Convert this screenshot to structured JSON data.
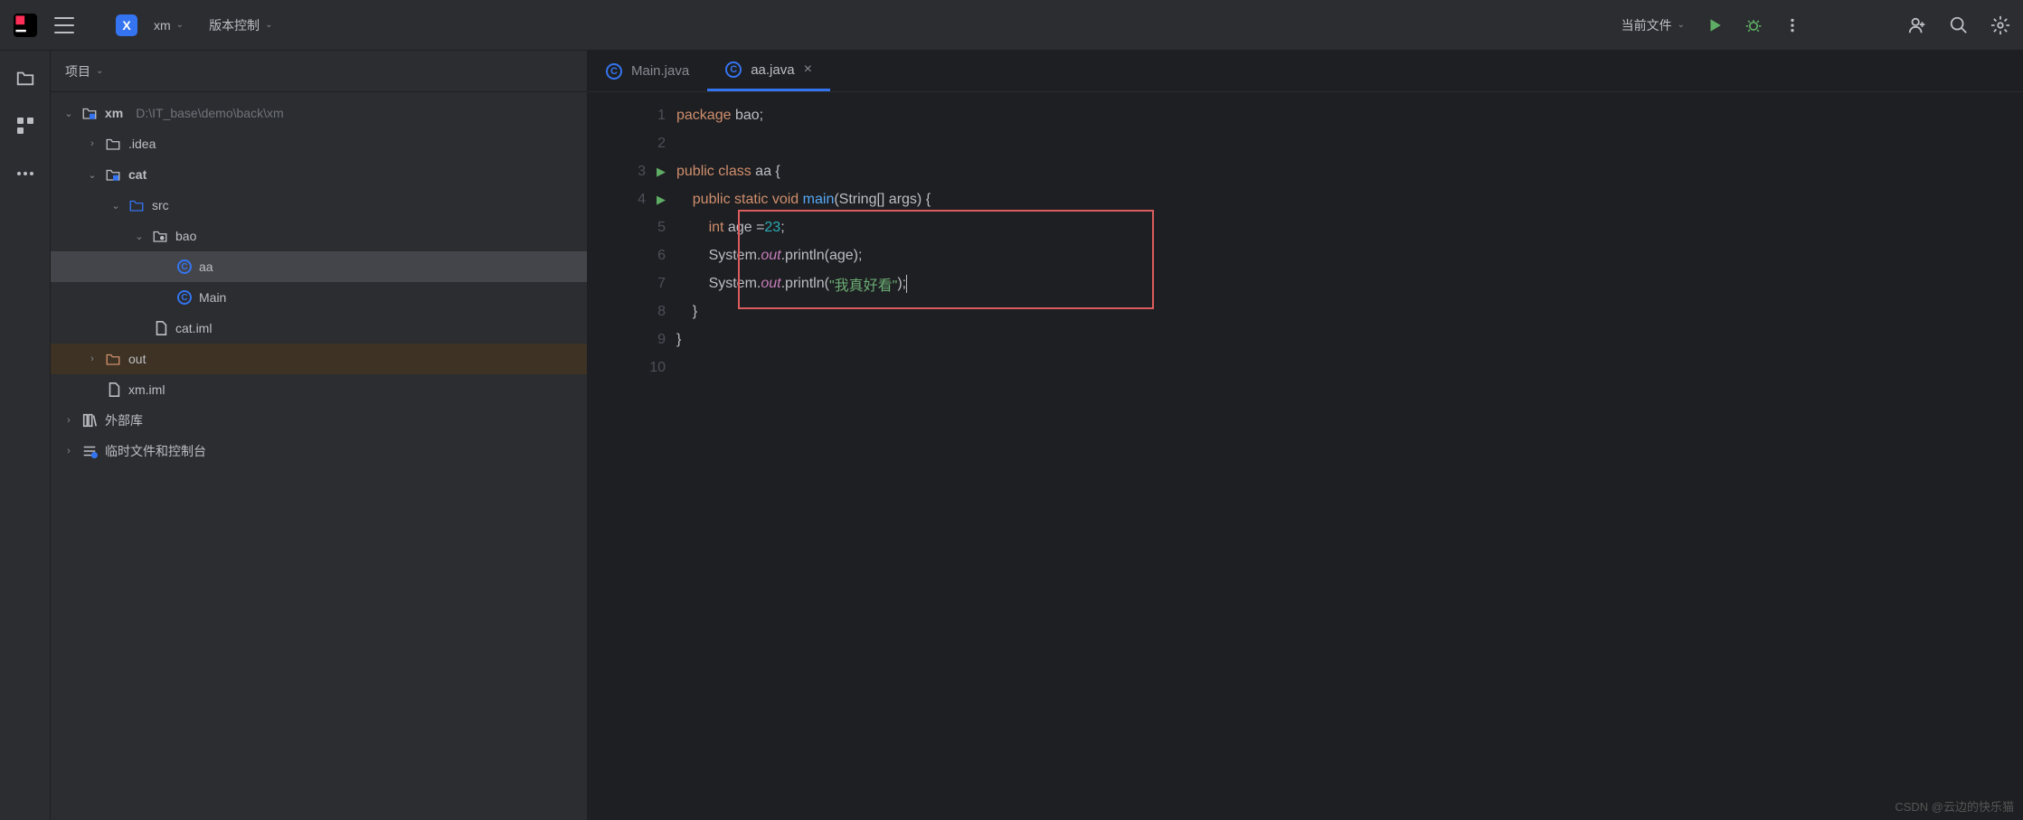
{
  "topbar": {
    "project_badge": "X",
    "project_name": "xm",
    "vcs_label": "版本控制",
    "run_config": "当前文件"
  },
  "sidebar": {
    "title": "项目",
    "root": {
      "name": "xm",
      "path": "D:\\IT_base\\demo\\back\\xm"
    },
    "idea": ".idea",
    "cat": "cat",
    "src": "src",
    "bao": "bao",
    "aa": "aa",
    "main": "Main",
    "catiml": "cat.iml",
    "out": "out",
    "xmiml": "xm.iml",
    "ext_lib": "外部库",
    "scratch": "临时文件和控制台"
  },
  "tabs": {
    "t1": "Main.java",
    "t2": "aa.java"
  },
  "lines": [
    "1",
    "2",
    "3",
    "4",
    "5",
    "6",
    "7",
    "8",
    "9",
    "10"
  ],
  "code": {
    "l1": {
      "pkg": "package",
      "sp": " ",
      "bao": "bao",
      "semi": ";"
    },
    "l3": {
      "pub": "public",
      "sp": " ",
      "cls": "class",
      "sp2": " ",
      "aa": "aa",
      "sp3": " ",
      "br": "{"
    },
    "l4": {
      "ind": "    ",
      "pub": "public",
      "sp": " ",
      "st": "static",
      "sp2": " ",
      "vd": "void",
      "sp3": " ",
      "main": "main",
      "par": "(String[] args) {"
    },
    "l5": {
      "ind": "        ",
      "int": "int",
      "sp": " ",
      "age": "age =",
      "num": "23",
      "semi": ";"
    },
    "l6": {
      "ind": "        ",
      "sys": "System.",
      "out": "out",
      "pr": ".println(age);"
    },
    "l7": {
      "ind": "        ",
      "sys": "System.",
      "out": "out",
      "pr": ".println(",
      "str": "\"我真好看\"",
      "end": ");"
    },
    "l8": {
      "ind": "    ",
      "br": "}"
    },
    "l9": {
      "br": "}"
    }
  },
  "watermark": "CSDN @云边的快乐猫"
}
